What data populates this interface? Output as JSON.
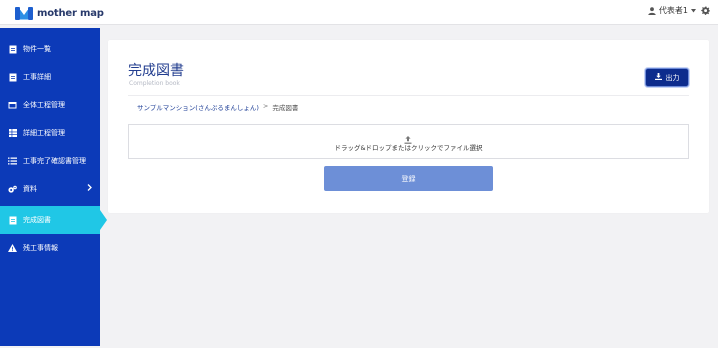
{
  "header": {
    "logo_text": "mother map",
    "user_name": "代表者1",
    "icons": {
      "user": "user-icon",
      "caret": "caret-down-icon",
      "settings": "gear-icon"
    }
  },
  "sidebar": {
    "items": [
      {
        "label": "物件一覧",
        "icon": "document-icon",
        "active": false
      },
      {
        "label": "工事詳細",
        "icon": "document-icon",
        "active": false
      },
      {
        "label": "全体工程管理",
        "icon": "calendar-icon",
        "active": false
      },
      {
        "label": "詳細工程管理",
        "icon": "grid-icon",
        "active": false
      },
      {
        "label": "工事完了確認書管理",
        "icon": "list-icon",
        "active": false
      },
      {
        "label": "資料",
        "icon": "gears-icon",
        "active": false,
        "has_submenu": true
      },
      {
        "label": "完成図書",
        "icon": "book-icon",
        "active": true
      },
      {
        "label": "残工事情報",
        "icon": "warning-icon",
        "active": false
      }
    ],
    "colors": {
      "background": "#0c3ab8",
      "active": "#20c7e6"
    }
  },
  "main": {
    "title": "完成図書",
    "subtitle": "Completion book",
    "output_button_label": "出力",
    "breadcrumb": {
      "link": "サンプルマンション(さんぷるまんしょん)",
      "separator": ">",
      "current": "完成図書"
    },
    "dropzone_text": "ドラッグ&ドロップまたはクリックでファイル選択",
    "submit_label": "登録"
  }
}
